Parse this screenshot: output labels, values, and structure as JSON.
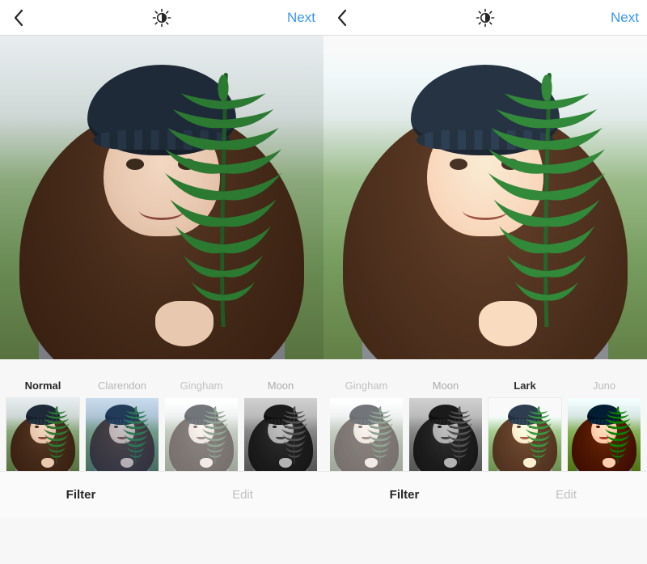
{
  "header": {
    "next_label": "Next"
  },
  "tabs": {
    "filter": "Filter",
    "edit": "Edit"
  },
  "left": {
    "selected_filter": "Normal",
    "filters": [
      {
        "name": "Normal",
        "style": "f-normal",
        "selected": true
      },
      {
        "name": "Clarendon",
        "style": "f-clarendon",
        "selected": false
      },
      {
        "name": "Gingham",
        "style": "f-gingham",
        "selected": false
      },
      {
        "name": "Moon",
        "style": "f-moon",
        "selected": false
      }
    ]
  },
  "right": {
    "selected_filter": "Lark",
    "filters": [
      {
        "name": "Gingham",
        "style": "f-gingham",
        "selected": false
      },
      {
        "name": "Moon",
        "style": "f-moon",
        "selected": false
      },
      {
        "name": "Lark",
        "style": "f-lark",
        "selected": true
      },
      {
        "name": "Juno",
        "style": "f-juno",
        "selected": false
      }
    ]
  },
  "colors": {
    "accent": "#3897f0"
  }
}
